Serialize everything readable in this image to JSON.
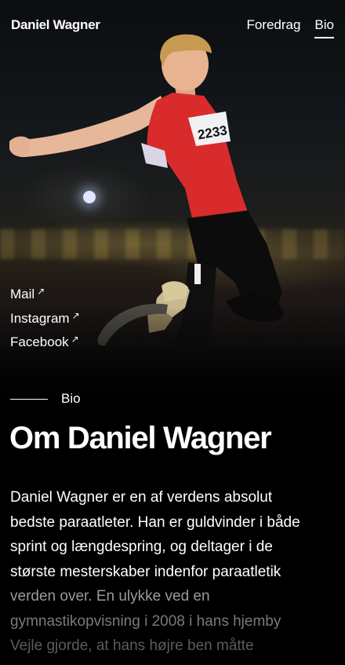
{
  "header": {
    "brand": "Daniel Wagner",
    "nav": [
      {
        "label": "Foredrag",
        "active": false
      },
      {
        "label": "Bio",
        "active": true
      }
    ]
  },
  "social": [
    {
      "label": "Mail",
      "icon": "external-arrow-icon"
    },
    {
      "label": "Instagram",
      "icon": "external-arrow-icon"
    },
    {
      "label": "Facebook",
      "icon": "external-arrow-icon"
    }
  ],
  "hero": {
    "bib_number": "2233"
  },
  "section": {
    "label": "Bio",
    "title": "Om Daniel Wagner"
  },
  "bio": {
    "lines": [
      "Daniel Wagner er en af verdens absolut",
      "bedste paraatleter. Han er guldvinder i både",
      "sprint og længdespring, og deltager i de",
      "største mesterskaber indenfor paraatletik",
      "verden over. En ulykke ved en",
      "gymnastikopvisning i 2008 i hans hjemby",
      "Vejle gjorde, at hans højre ben måtte"
    ],
    "line_colors": [
      "#ffffff",
      "#ffffff",
      "#ffffff",
      "#ffffff",
      "#9a9a9a",
      "#7a7a7a",
      "#5c5c5c"
    ]
  },
  "colors": {
    "background": "#000000",
    "text": "#ffffff",
    "jersey": "#d92b2b"
  }
}
